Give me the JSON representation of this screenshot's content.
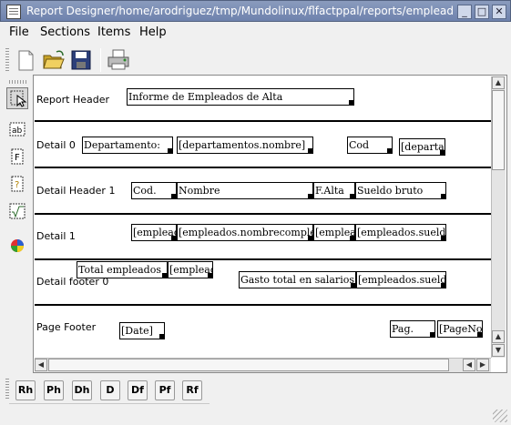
{
  "window": {
    "title": "Report Designer/home/arodriguez/tmp/Mundolinux/flfactppal/reports/empleados.kut",
    "btn_min": "_",
    "btn_max": "□",
    "btn_close": "✕"
  },
  "menu": [
    "File",
    "Sections",
    "Items",
    "Help"
  ],
  "toolbar": [
    "new-icon",
    "open-folder-icon",
    "save-icon",
    "print-preview-icon"
  ],
  "tools": [
    "pointer-icon",
    "label-icon",
    "field-icon",
    "special-icon",
    "calculated-icon",
    "chart-icon"
  ],
  "sections": [
    "Report Header",
    "Detail 0",
    "Detail Header 1",
    "Detail 1",
    "Detail footer 0",
    "Page Footer"
  ],
  "items": {
    "report_title": "Informe de Empleados de Alta",
    "d0_label": "Departamento:",
    "d0_field": "[departamentos.nombre]",
    "d0_cod": "Cod",
    "d0_cod_field": "[departamentos.codd",
    "dh1_cod": "Cod.",
    "dh1_nombre": "Nombre",
    "dh1_falta": "F.Alta",
    "dh1_sueldo": "Sueldo bruto",
    "d1_cod": "[empleados.codemp",
    "d1_nombre": "[empleados.nombrecompleto",
    "d1_falta": "[empleados.fecha",
    "d1_sueldo": "[empleados.sueldobruto]",
    "df0_total": "Total empleados",
    "df0_count": "[empleados.",
    "df0_gasto": "Gasto total en salarios",
    "df0_gasto_field": "[empleados.sueldobruto]",
    "pf_date": "[Date]",
    "pf_pag": "Pag.",
    "pf_pageno": "[PageNo]"
  },
  "bottom": [
    "Rh",
    "Ph",
    "Dh",
    "D",
    "Df",
    "Pf",
    "Rf"
  ],
  "colors": {
    "titlebar": "#7487b3",
    "canvas": "#ffffff",
    "section_line": "#000000"
  }
}
